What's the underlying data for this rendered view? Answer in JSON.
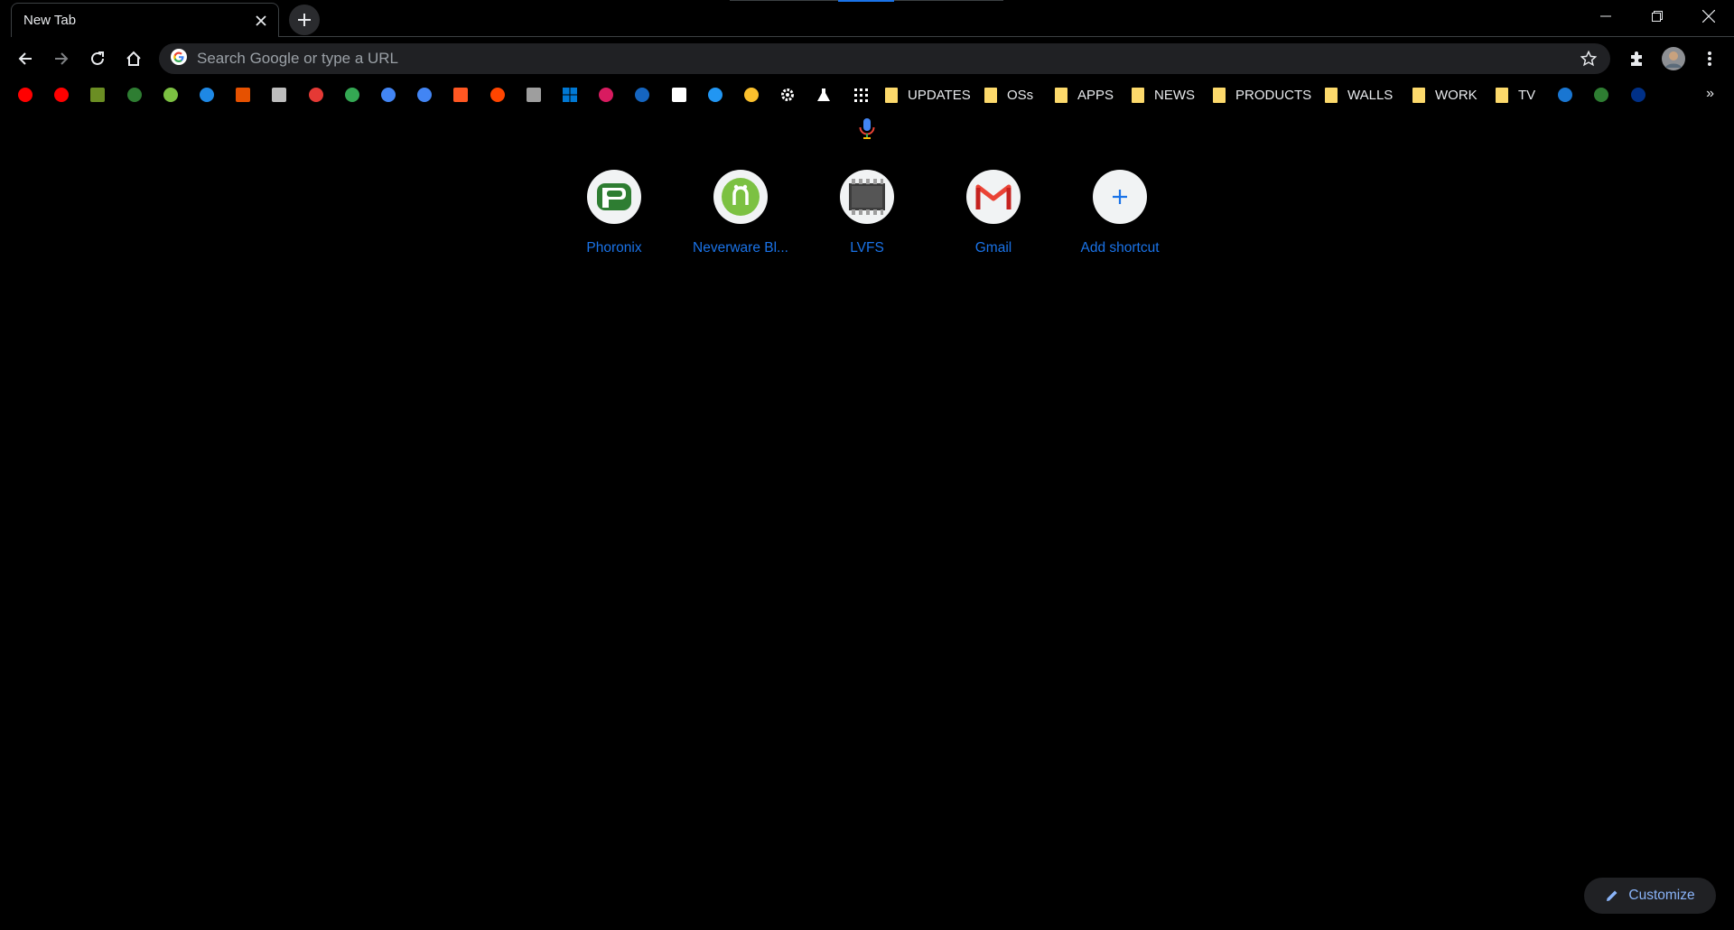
{
  "tab": {
    "title": "New Tab"
  },
  "omnibox": {
    "placeholder": "Search Google or type a URL"
  },
  "bookmarks": {
    "icons": [
      {
        "name": "youtube-icon",
        "color": "#ff0000"
      },
      {
        "name": "youtube-music-icon",
        "color": "#ff0000"
      },
      {
        "name": "photo-site-icon",
        "color": "#6b8e23"
      },
      {
        "name": "phoronix-icon",
        "color": "#2e7d32"
      },
      {
        "name": "neverware-icon",
        "color": "#7cc142"
      },
      {
        "name": "onedrive-icon",
        "color": "#1e88e5"
      },
      {
        "name": "office-icon",
        "color": "#e65100"
      },
      {
        "name": "news-site-icon",
        "color": "#bdbdbd"
      },
      {
        "name": "video-site-icon",
        "color": "#e53935"
      },
      {
        "name": "chrome-icon",
        "color": "#34a853"
      },
      {
        "name": "chrome-web-store-icon",
        "color": "#4285f4"
      },
      {
        "name": "google-icon",
        "color": "#4285f4"
      },
      {
        "name": "blogger-icon",
        "color": "#ff5722"
      },
      {
        "name": "reddit-icon",
        "color": "#ff4500"
      },
      {
        "name": "lvfs-icon",
        "color": "#9e9e9e"
      },
      {
        "name": "windows-icon",
        "color": "#0078d4"
      },
      {
        "name": "winaero-icon",
        "color": "#d81b60"
      },
      {
        "name": "globe-site-icon",
        "color": "#1565c0"
      },
      {
        "name": "kg-icon",
        "color": "#ffffff"
      },
      {
        "name": "xda-icon",
        "color": "#2196f3"
      },
      {
        "name": "lightbulb-icon",
        "color": "#fbc02d"
      },
      {
        "name": "settings-gear-icon",
        "color": "#ffffff"
      },
      {
        "name": "flask-labs-icon",
        "color": "#ffffff"
      },
      {
        "name": "apps-grid-icon",
        "color": "#ffffff"
      }
    ],
    "folders": [
      {
        "label": "UPDATES"
      },
      {
        "label": "OSs"
      },
      {
        "label": "APPS"
      },
      {
        "label": "NEWS"
      },
      {
        "label": "PRODUCTS"
      },
      {
        "label": "WALLS"
      },
      {
        "label": "WORK"
      },
      {
        "label": "TV"
      }
    ],
    "trailing_icons": [
      {
        "name": "er-site-icon",
        "color": "#1976d2"
      },
      {
        "name": "green-circle-site-icon",
        "color": "#2e7d32"
      },
      {
        "name": "paypal-icon",
        "color": "#003087"
      }
    ],
    "more": "»"
  },
  "shortcuts": [
    {
      "label": "Phoronix",
      "icon": "phoronix-logo-icon"
    },
    {
      "label": "Neverware Bl...",
      "icon": "neverware-logo-icon"
    },
    {
      "label": "LVFS",
      "icon": "chip-icon"
    },
    {
      "label": "Gmail",
      "icon": "gmail-icon"
    },
    {
      "label": "Add shortcut",
      "icon": "plus-icon"
    }
  ],
  "customize": {
    "label": "Customize"
  },
  "colors": {
    "accent": "#1a73e8",
    "link": "#8ab4f8",
    "folder": "#fcd96b"
  }
}
